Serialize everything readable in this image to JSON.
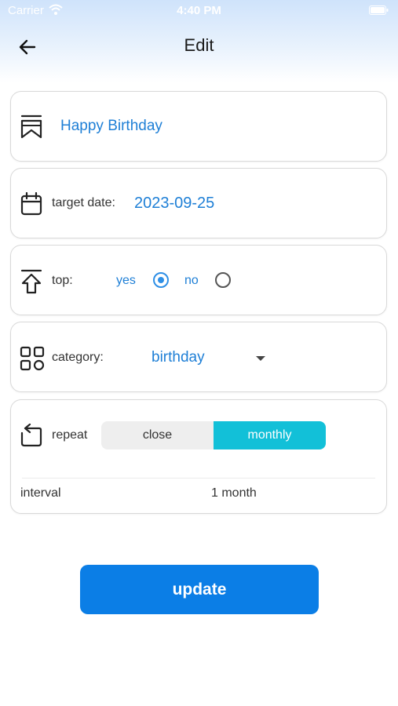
{
  "status_bar": {
    "carrier": "Carrier",
    "time": "4:40 PM"
  },
  "nav": {
    "title": "Edit"
  },
  "title_field": {
    "value": "Happy Birthday"
  },
  "target_date": {
    "label": "target date:",
    "value": "2023-09-25"
  },
  "top": {
    "label": "top:",
    "option_yes": "yes",
    "option_no": "no",
    "selected": "yes"
  },
  "category": {
    "label": "category:",
    "value": "birthday"
  },
  "repeat": {
    "label": "repeat",
    "options": [
      "close",
      "monthly"
    ],
    "selected": "monthly",
    "interval_label": "interval",
    "interval_value": "1 month"
  },
  "update_button": {
    "label": "update"
  },
  "colors": {
    "accent": "#1e7fd6",
    "button": "#0b7ee6",
    "segment_active": "#12c0d8"
  }
}
